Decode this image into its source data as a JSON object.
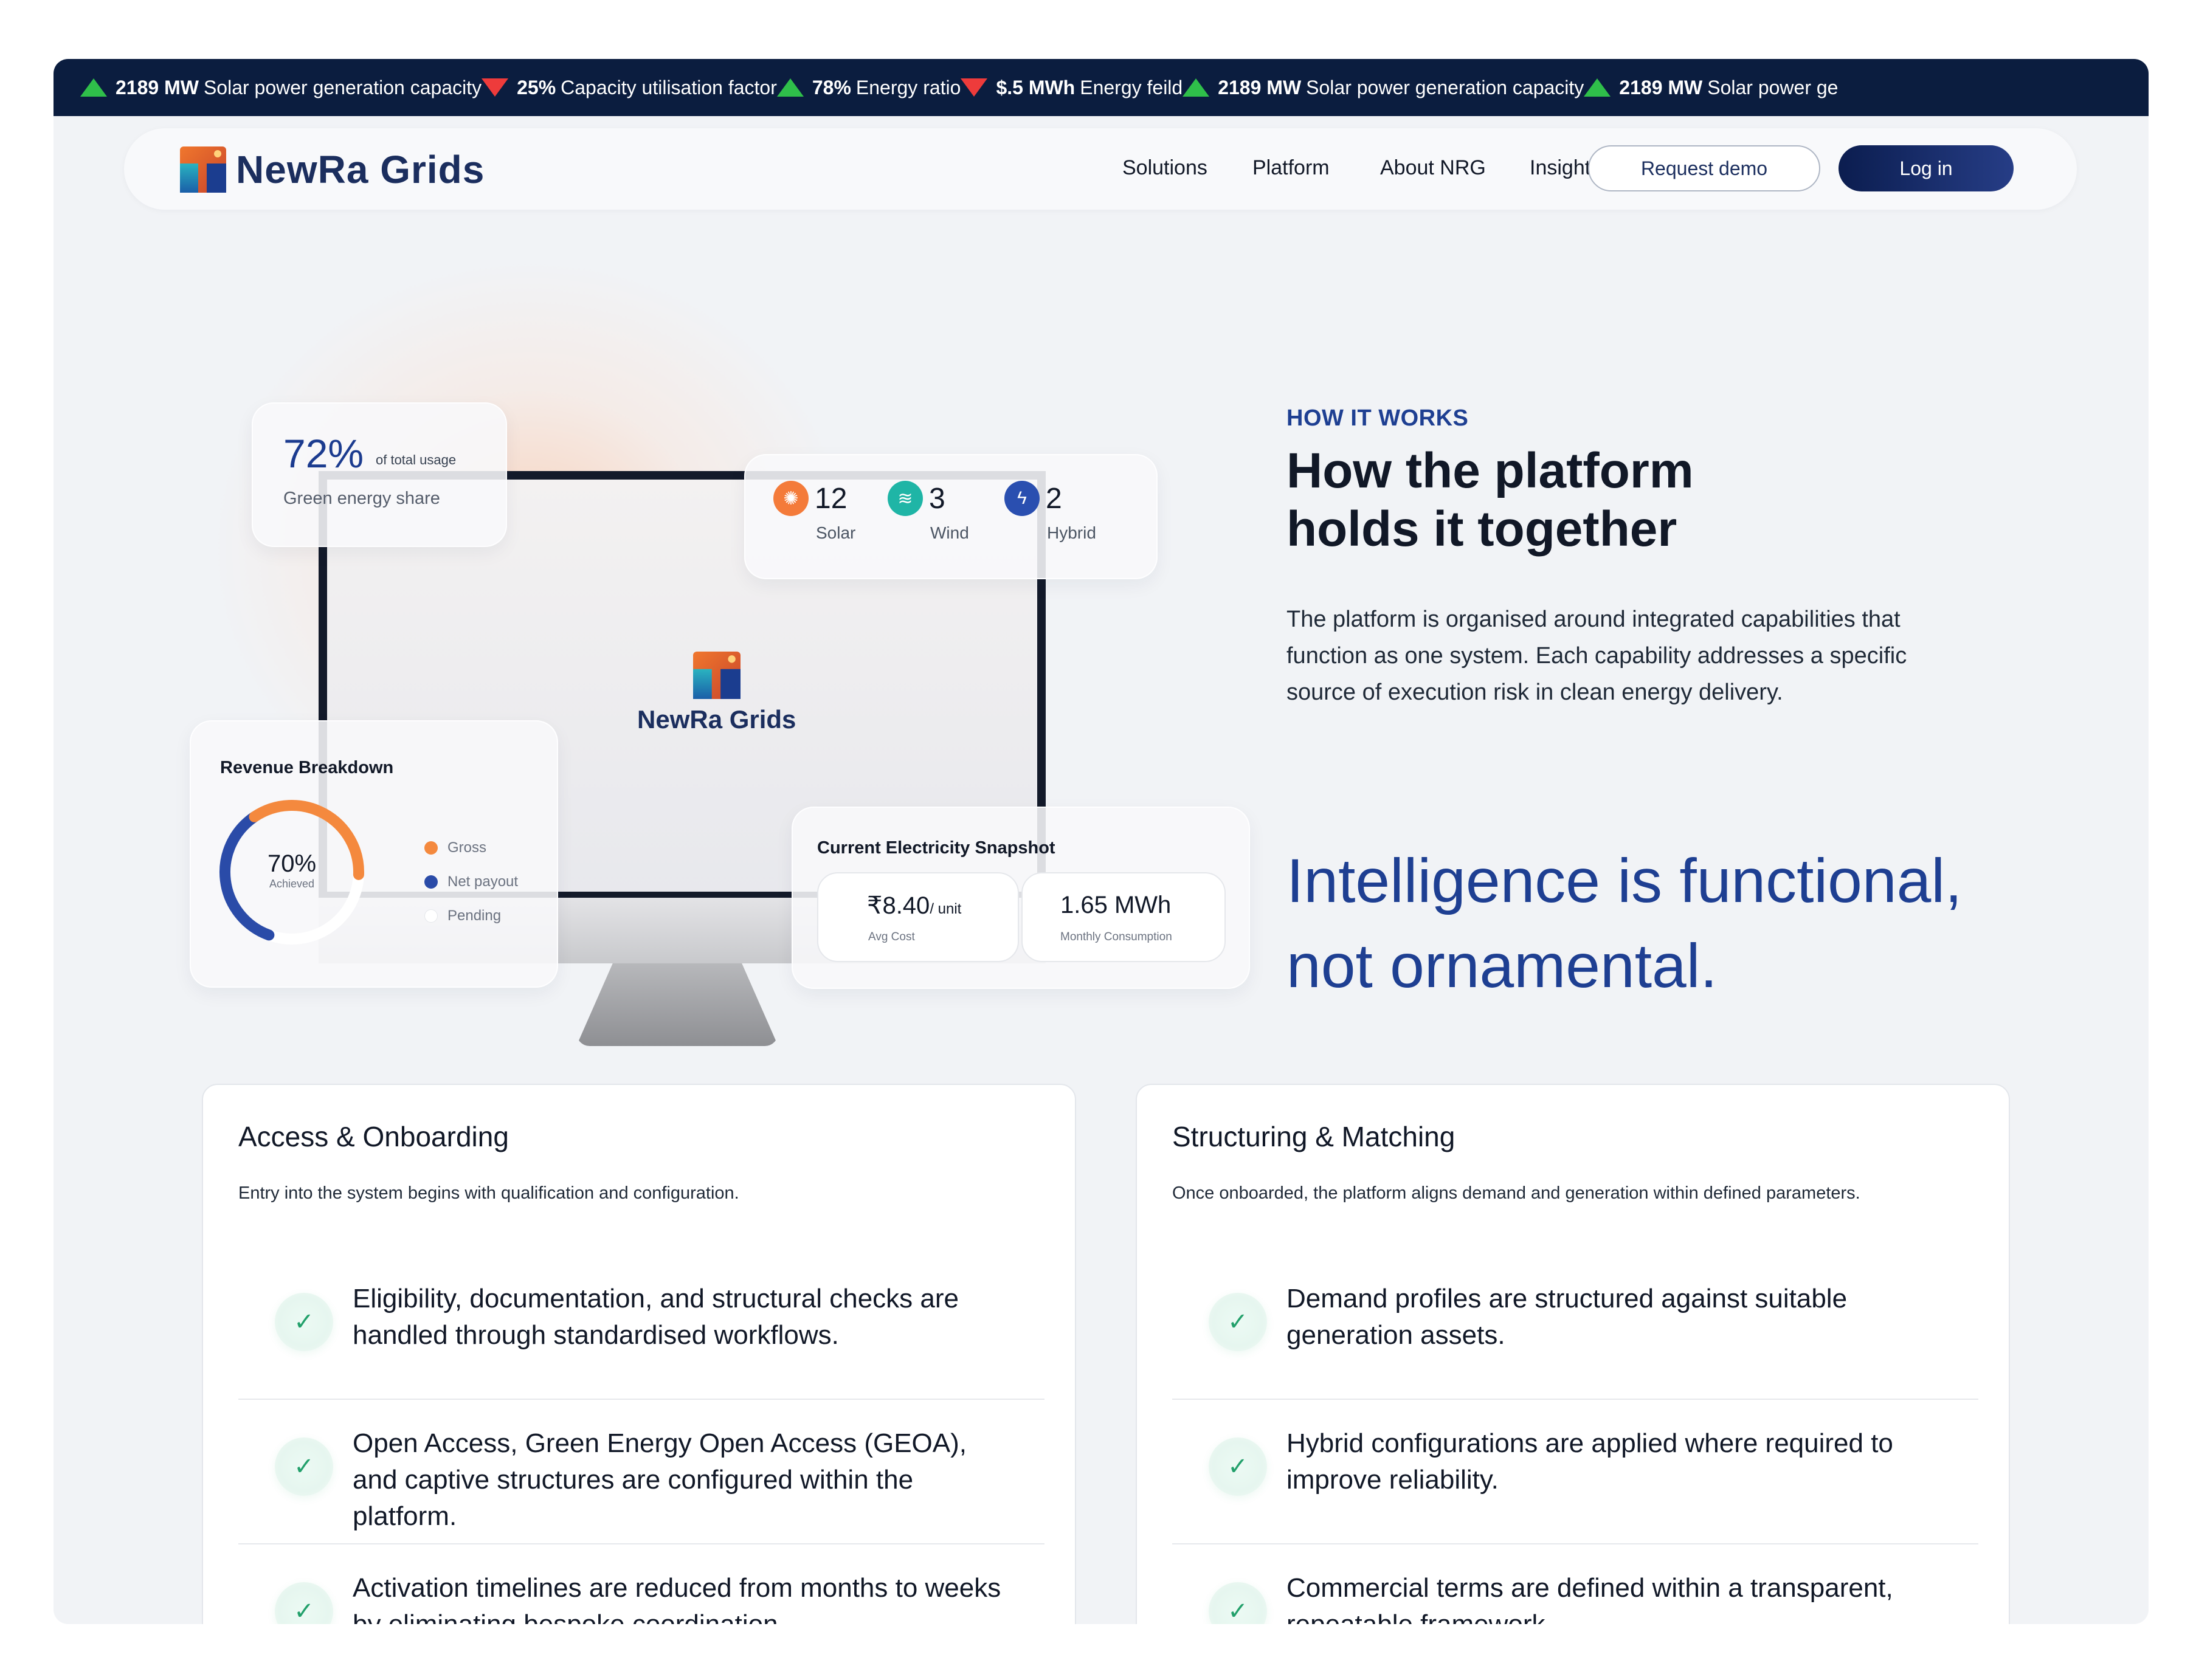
{
  "ticker": [
    {
      "dir": "up",
      "value": "2189 MW",
      "label": "Solar power generation capacity"
    },
    {
      "dir": "down",
      "value": "25%",
      "label": "Capacity utilisation factor"
    },
    {
      "dir": "up",
      "value": "78%",
      "label": "Energy ratio"
    },
    {
      "dir": "down",
      "value": "$.5 MWh",
      "label": "Energy feild"
    },
    {
      "dir": "up",
      "value": "2189 MW",
      "label": "Solar power generation capacity"
    },
    {
      "dir": "up",
      "value": "2189 MW",
      "label": "Solar power ge"
    }
  ],
  "nav": {
    "brand": "NewRa Grids",
    "links": [
      "Solutions",
      "Platform",
      "About NRG",
      "Insights"
    ],
    "request_demo": "Request demo",
    "login": "Log in"
  },
  "hero": {
    "monitor_brand": "NewRa Grids",
    "green": {
      "pct": "72%",
      "of": "of total usage",
      "label": "Green energy share"
    },
    "assets": [
      {
        "icon": "sun-icon",
        "num": "12",
        "name": "Solar",
        "color": "#f47b3a"
      },
      {
        "icon": "wind-icon",
        "num": "3",
        "name": "Wind",
        "color": "#1fb5a6"
      },
      {
        "icon": "hybrid-bolt-icon",
        "num": "2",
        "name": "Hybrid",
        "color": "#2a4fb0"
      }
    ],
    "revenue": {
      "title": "Revenue Breakdown",
      "value": "70%",
      "sub": "Achieved",
      "achieved_fraction": 0.7,
      "legend": [
        {
          "name": "Gross",
          "color": "#f4893e"
        },
        {
          "name": "Net payout",
          "color": "#2a4ba8"
        },
        {
          "name": "Pending",
          "color": "#ffffff"
        }
      ]
    },
    "snapshot": {
      "title": "Current Electricity Snapshot",
      "cost_value": "₹8.40",
      "cost_unit": "/ unit",
      "cost_label": "Avg Cost",
      "consumption_value": "1.65 MWh",
      "consumption_label": "Monthly Consumption"
    },
    "eyebrow": "HOW IT WORKS",
    "heading_line1": "How the platform",
    "heading_line2": "holds it together",
    "paragraph": "The platform is organised around integrated capabilities that function as one system. Each capability addresses a specific source of execution risk in clean energy delivery.",
    "tagline_line1": "Intelligence is functional,",
    "tagline_line2": "not ornamental."
  },
  "panels": [
    {
      "title": "Access & Onboarding",
      "subtitle": "Entry into the system begins with qualification and configuration.",
      "items": [
        "Eligibility, documentation, and structural checks are handled through standardised workflows.",
        "Open Access, Green Energy Open Access (GEOA), and captive structures are configured within the platform.",
        "Activation timelines are reduced from months to weeks by eliminating bespoke coordination."
      ]
    },
    {
      "title": "Structuring & Matching",
      "subtitle": "Once onboarded, the platform aligns demand and generation within defined parameters.",
      "items": [
        "Demand profiles are structured against suitable generation assets.",
        "Hybrid configurations are applied where required to improve reliability.",
        "Commercial terms are defined within a transparent, repeatable framework."
      ]
    }
  ]
}
